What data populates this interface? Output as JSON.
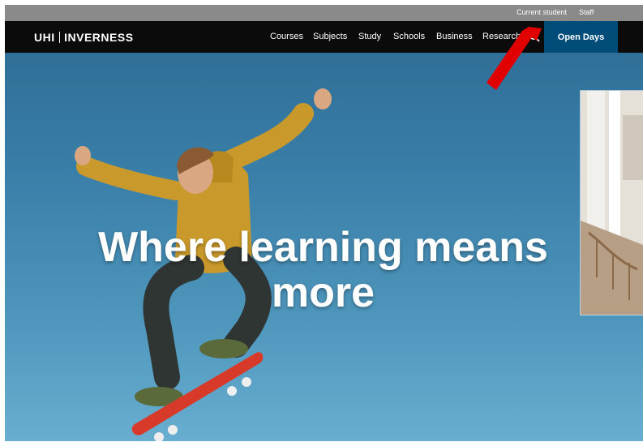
{
  "utility_bar": {
    "current_student": "Current student",
    "staff": "Staff"
  },
  "header": {
    "logo_left": "UHI",
    "logo_right": "INVERNESS",
    "nav": [
      "Courses",
      "Subjects",
      "Study",
      "Schools",
      "Business",
      "Research"
    ],
    "search_icon": "search-icon",
    "open_days": "Open Days"
  },
  "hero": {
    "headline": "Where learning means more",
    "image": "skateboarder jumping against blue sky"
  },
  "side_panel": {
    "image": "building interior staircase"
  },
  "annotation": {
    "arrow_color": "#e00000"
  },
  "colors": {
    "utility_bar": "#8a8a8a",
    "nav_background": "#0b0b0b",
    "open_days_background": "#004d7a",
    "sky": "#3b81aa"
  }
}
